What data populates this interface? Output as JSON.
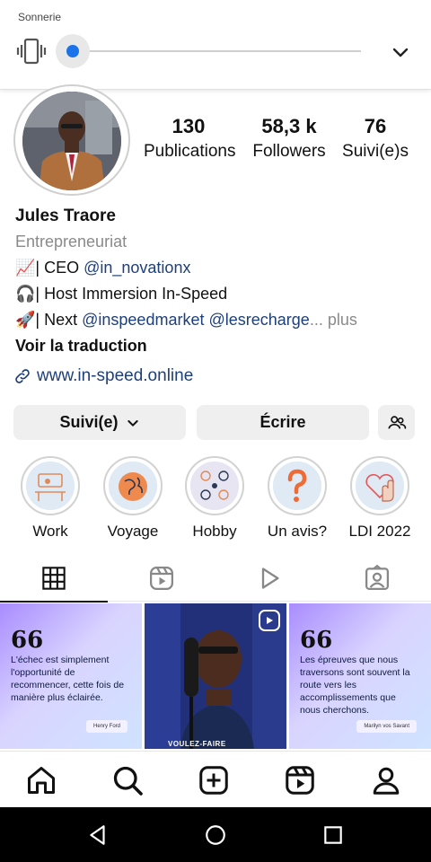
{
  "volume": {
    "title": "Sonnerie",
    "level_fraction": 0.0
  },
  "profile": {
    "stats": [
      {
        "value": "130",
        "label": "Publications"
      },
      {
        "value": "58,3 k",
        "label": "Followers"
      },
      {
        "value": "76",
        "label": "Suivi(e)s"
      }
    ],
    "name": "Jules Traore",
    "category": "Entrepreneuriat",
    "bio": {
      "line1_prefix": "| CEO ",
      "line1_mention": "@in_novationx",
      "line2": "| Host Immersion In-Speed",
      "line3_prefix": "| Next ",
      "line3_mention1": "@inspeedmarket",
      "line3_mention2": "@lesrecharge",
      "line3_ellipsis": "...",
      "line3_more": " plus"
    },
    "see_translation": "Voir la traduction",
    "website": "www.in-speed.online"
  },
  "buttons": {
    "following": "Suivi(e)",
    "message": "Écrire"
  },
  "highlights": [
    {
      "label": "Work"
    },
    {
      "label": "Voyage"
    },
    {
      "label": "Hobby"
    },
    {
      "label": "Un avis?"
    },
    {
      "label": "LDI 2022"
    }
  ],
  "posts": {
    "post1": {
      "quote_mark": "66",
      "text": "L'échec est simplement l'opportunité de recommencer, cette fois de manière plus éclairée.",
      "author": "Henry Ford"
    },
    "post2": {
      "caption": "VOULEZ-FAIRE"
    },
    "post3": {
      "quote_mark": "66",
      "text": "Les épreuves que nous traversons sont souvent la route vers les accomplissements que nous cherchons.",
      "author": "Marilyn vos Savant"
    }
  },
  "colors": {
    "accent": "#1a73e8",
    "link": "#1d3f7a",
    "button_bg": "#efefef",
    "muted": "#8a8a8a"
  },
  "icons": {
    "vibrate": "vibrate-icon",
    "expand": "chevron-down-icon",
    "link": "link-icon",
    "discover_people": "add-people-icon",
    "tabs": [
      "grid-icon",
      "reels-icon",
      "video-icon",
      "tagged-icon"
    ],
    "nav": [
      "home-icon",
      "search-icon",
      "create-icon",
      "reels-icon",
      "profile-icon"
    ]
  }
}
